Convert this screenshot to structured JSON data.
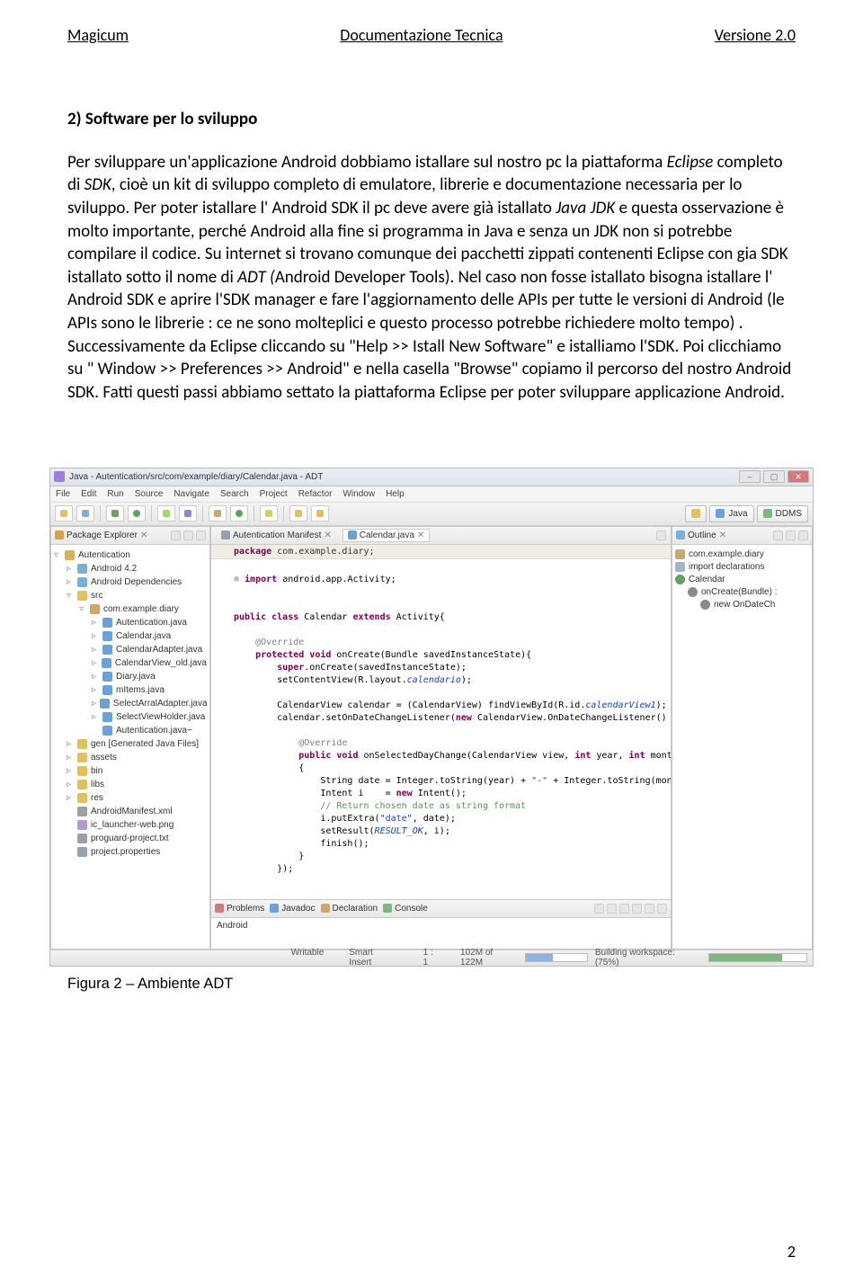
{
  "header": {
    "left": "Magicum",
    "center": "Documentazione Tecnica",
    "right": "Versione 2.0"
  },
  "article": {
    "heading": "2) Software per lo sviluppo",
    "body1": "Per sviluppare un'applicazione Android dobbiamo istallare sul nostro pc la piattaforma ",
    "body1i": "Eclipse",
    "body2": " completo di ",
    "body2i": "SDK",
    "body3": ", cioè un kit di sviluppo completo di emulatore, librerie e documentazione necessaria per lo sviluppo. Per poter istallare l' Android SDK il pc deve avere già istallato ",
    "body3i": "Java JDK",
    "body4": " e questa osservazione è molto importante, perché Android alla fine si programma in Java e senza un JDK non si potrebbe compilare il codice. Su internet si trovano comunque dei pacchetti zippati contenenti Eclipse con gia SDK istallato sotto il nome di ",
    "body4i": "ADT (",
    "body5": "Android Developer Tools). Nel caso non fosse istallato bisogna istallare l' Android SDK e aprire l'SDK manager e fare l'aggiornamento delle APIs  per tutte le versioni di Android (le APIs sono le librerie : ce ne sono molteplici e questo processo potrebbe richiedere molto tempo) .",
    "body6": "Successivamente da Eclipse cliccando su \"Help >> Istall New Software\" e istalliamo l'SDK. Poi clicchiamo su \" Window >> Preferences >> Android\"  e nella casella \"Browse\" copiamo il percorso del nostro Android SDK. Fatti questi passi abbiamo settato la piattaforma Eclipse per poter sviluppare applicazione Android."
  },
  "ide": {
    "title": "Java - Autentication/src/com/example/diary/Calendar.java - ADT",
    "menus": [
      "File",
      "Edit",
      "Run",
      "Source",
      "Navigate",
      "Search",
      "Project",
      "Refactor",
      "Window",
      "Help"
    ],
    "perspectives": [
      {
        "label": "Java",
        "color": "#6aa2d8"
      },
      {
        "label": "DDMS",
        "color": "#7fb57f"
      }
    ],
    "pkgexp_tab": "Package Explorer",
    "tree": [
      {
        "ind": 0,
        "tw": "▿",
        "icon": "ic-proj",
        "label": "Autentication"
      },
      {
        "ind": 1,
        "tw": "▹",
        "icon": "ic-lib",
        "label": "Android 4.2"
      },
      {
        "ind": 1,
        "tw": "▹",
        "icon": "ic-lib",
        "label": "Android Dependencies"
      },
      {
        "ind": 1,
        "tw": "▿",
        "icon": "ic-folder",
        "label": "src"
      },
      {
        "ind": 2,
        "tw": "▿",
        "icon": "ic-pkg",
        "label": "com.example.diary"
      },
      {
        "ind": 3,
        "tw": "▹",
        "icon": "ic-java",
        "label": "Autentication.java"
      },
      {
        "ind": 3,
        "tw": "▹",
        "icon": "ic-java",
        "label": "Calendar.java"
      },
      {
        "ind": 3,
        "tw": "▹",
        "icon": "ic-java",
        "label": "CalendarAdapter.java"
      },
      {
        "ind": 3,
        "tw": "▹",
        "icon": "ic-java",
        "label": "CalendarView_old.java"
      },
      {
        "ind": 3,
        "tw": "▹",
        "icon": "ic-java",
        "label": "Diary.java"
      },
      {
        "ind": 3,
        "tw": "▹",
        "icon": "ic-java",
        "label": "mItems.java"
      },
      {
        "ind": 3,
        "tw": "▹",
        "icon": "ic-java",
        "label": "SelectArralAdapter.java"
      },
      {
        "ind": 3,
        "tw": "▹",
        "icon": "ic-java",
        "label": "SelectViewHolder.java"
      },
      {
        "ind": 3,
        "tw": "",
        "icon": "ic-java",
        "label": "Autentication.java~"
      },
      {
        "ind": 1,
        "tw": "▹",
        "icon": "ic-folder",
        "label": "gen [Generated Java Files]"
      },
      {
        "ind": 1,
        "tw": "▹",
        "icon": "ic-folder",
        "label": "assets"
      },
      {
        "ind": 1,
        "tw": "▹",
        "icon": "ic-folder",
        "label": "bin"
      },
      {
        "ind": 1,
        "tw": "▹",
        "icon": "ic-folder",
        "label": "libs"
      },
      {
        "ind": 1,
        "tw": "▹",
        "icon": "ic-folder",
        "label": "res"
      },
      {
        "ind": 1,
        "tw": "",
        "icon": "ic-xml",
        "label": "AndroidManifest.xml"
      },
      {
        "ind": 1,
        "tw": "",
        "icon": "ic-png",
        "label": "ic_launcher-web.png"
      },
      {
        "ind": 1,
        "tw": "",
        "icon": "ic-txt",
        "label": "proguard-project.txt"
      },
      {
        "ind": 1,
        "tw": "",
        "icon": "ic-txt",
        "label": "project.properties"
      }
    ],
    "editor_tabs": [
      {
        "label": "Autentication Manifest",
        "icon": "#9aa0a8",
        "active": false
      },
      {
        "label": "Calendar.java",
        "icon": "#6aa2d8",
        "active": true
      }
    ],
    "code_pkgline": "package com.example.diary;",
    "code": [
      {
        "t": ""
      },
      {
        "t": "+ import android.app.Activity;",
        "cls": "kw",
        "raw": true
      },
      {
        "t": ""
      },
      {
        "t": ""
      },
      {
        "t": "public class Calendar extends Activity{",
        "repl": [
          [
            "public class",
            "kw"
          ],
          [
            "extends",
            "kw"
          ]
        ]
      },
      {
        "t": ""
      },
      {
        "t": "    @Override",
        "cls": "ann"
      },
      {
        "t": "    protected void onCreate(Bundle savedInstanceState){",
        "repl": [
          [
            "protected void",
            "kw"
          ]
        ]
      },
      {
        "t": "        super.onCreate(savedInstanceState);",
        "repl": [
          [
            "super",
            "kw"
          ]
        ]
      },
      {
        "t": "        setContentView(R.layout.calendario);",
        "repl": [
          [
            "calendario",
            "fld"
          ]
        ]
      },
      {
        "t": ""
      },
      {
        "t": "        CalendarView calendar = (CalendarView) findViewById(R.id.calendarView1);",
        "repl": [
          [
            "calendarView1",
            "fld"
          ]
        ]
      },
      {
        "t": "        calendar.setOnDateChangeListener(new CalendarView.OnDateChangeListener() {",
        "repl": [
          [
            "new",
            "kw"
          ]
        ]
      },
      {
        "t": ""
      },
      {
        "t": "            @Override",
        "cls": "ann"
      },
      {
        "t": "            public void onSelectedDayChange(CalendarView view, int year, int month, int dayOfMonth)",
        "repl": [
          [
            "public void",
            "kw"
          ],
          [
            "int",
            "kw"
          ]
        ]
      },
      {
        "t": "            {"
      },
      {
        "t": "                String date = Integer.toString(year) + \"-\" + Integer.toString(month) + \"-\" + Integer.toString(dayOfMonth);",
        "repl": [
          [
            "\"-\"",
            "str"
          ]
        ]
      },
      {
        "t": "                Intent i    = new Intent();",
        "repl": [
          [
            "new",
            "kw"
          ]
        ]
      },
      {
        "t": "                // Return chosen date as string format",
        "cls": "cm"
      },
      {
        "t": "                i.putExtra(\"date\", date);",
        "repl": [
          [
            "\"date\"",
            "str"
          ]
        ]
      },
      {
        "t": "                setResult(RESULT_OK, i);",
        "repl": [
          [
            "RESULT_OK",
            "fld"
          ]
        ]
      },
      {
        "t": "                finish();"
      },
      {
        "t": "            }"
      },
      {
        "t": "        });"
      },
      {
        "t": ""
      }
    ],
    "outline_tab": "Outline",
    "outline": [
      {
        "ind": 0,
        "icon": "ic-opkg",
        "label": "com.example.diary"
      },
      {
        "ind": 0,
        "icon": "ic-imp",
        "label": "import declarations"
      },
      {
        "ind": 0,
        "icon": "ic-class",
        "label": "Calendar"
      },
      {
        "ind": 1,
        "icon": "ic-meth",
        "label": "onCreate(Bundle) :"
      },
      {
        "ind": 2,
        "icon": "ic-meth",
        "label": "new OnDateCh"
      }
    ],
    "bottom_tabs": [
      "Problems",
      "Javadoc",
      "Declaration",
      "Console"
    ],
    "bottom_label": "Android",
    "status": {
      "writable": "Writable",
      "insert": "Smart Insert",
      "pos": "1 : 1",
      "mem": "102M of 122M",
      "task": "Building workspace: (75%)"
    }
  },
  "caption": "Figura 2 – Ambiente ADT",
  "page_number": "2"
}
